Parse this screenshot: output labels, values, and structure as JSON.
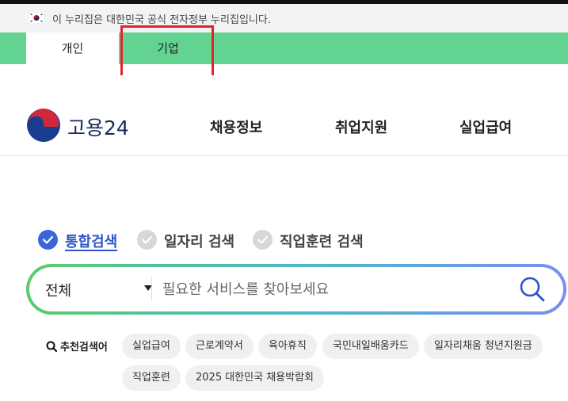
{
  "gov_banner": {
    "text": "이 누리집은 대한민국 공식 전자정부 누리집입니다."
  },
  "audience_tabs": [
    {
      "label": "개인",
      "active": true
    },
    {
      "label": "기업",
      "active": false
    }
  ],
  "header": {
    "logo_text": "고용24",
    "nav": [
      "채용정보",
      "취업지원",
      "실업급여"
    ]
  },
  "search": {
    "tabs": [
      {
        "label": "통합검색",
        "active": true
      },
      {
        "label": "일자리 검색",
        "active": false
      },
      {
        "label": "직업훈련 검색",
        "active": false
      }
    ],
    "scope_selected": "전체",
    "placeholder": "필요한 서비스를 찾아보세요",
    "value": ""
  },
  "recommended": {
    "label": "추천검색어",
    "keywords": [
      "실업급여",
      "근로계약서",
      "육아휴직",
      "국민내일배움카드",
      "일자리채움 청년지원금",
      "직업훈련",
      "2025 대한민국 채용박람회"
    ]
  },
  "colors": {
    "audience_bar": "#63d391",
    "highlight": "#e0242f",
    "active_search_tab": "#2f55c9",
    "logo_text": "#1a2a5a"
  }
}
